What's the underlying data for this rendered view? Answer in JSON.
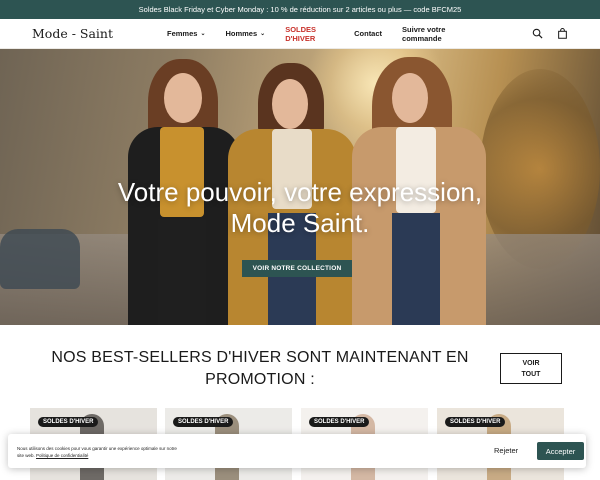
{
  "announcement": {
    "text": "Soldes Black Friday et Cyber Monday : 10 % de réduction sur 2 articles ou plus — code BFCM25"
  },
  "header": {
    "logo": "Mode - Saint",
    "nav": [
      {
        "label": "Femmes",
        "has_dropdown": true
      },
      {
        "label": "Hommes",
        "has_dropdown": true
      },
      {
        "label": "SOLDES D'HIVER",
        "has_dropdown": false,
        "highlight": "#c8312b"
      },
      {
        "label": "Contact",
        "has_dropdown": false
      },
      {
        "label": "Suivre votre commande",
        "has_dropdown": false
      }
    ],
    "icons": [
      "search-icon",
      "shopping-bag-icon"
    ]
  },
  "hero": {
    "title_line1": "Votre pouvoir, votre expression,",
    "title_line2": "Mode Saint.",
    "cta": "VOIR NOTRE COLLECTION"
  },
  "bestsellers": {
    "title": "NOS BEST-SELLERS D'HIVER SONT MAINTENANT EN PROMOTION :",
    "see_all_line1": "VOIR",
    "see_all_line2": "TOUT",
    "products": [
      {
        "badge": "SOLDES D'HIVER"
      },
      {
        "badge": "SOLDES D'HIVER"
      },
      {
        "badge": "SOLDES D'HIVER"
      },
      {
        "badge": "SOLDES D'HIVER"
      }
    ]
  },
  "cookie": {
    "text": "Nous utilisons des cookies pour vous garantir une expérience optimale sur notre site web.",
    "link": "Politique de confidentialité",
    "reject": "Rejeter",
    "accept": "Accepter"
  },
  "colors": {
    "brand": "#2d5452",
    "sale": "#c8312b",
    "badge": "#1a1a1a"
  }
}
